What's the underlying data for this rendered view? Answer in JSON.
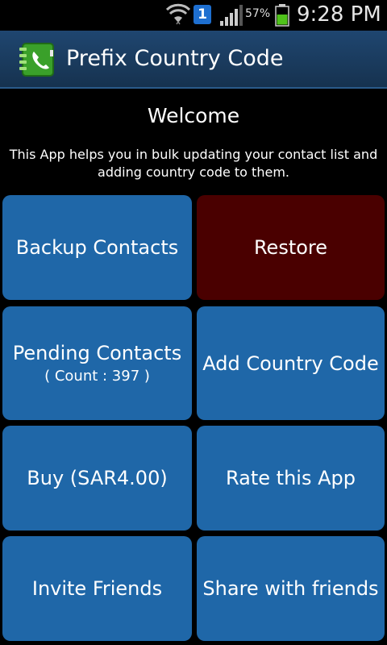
{
  "status_bar": {
    "notification_count": "1",
    "battery_percent": "57%",
    "time": "9:28 PM",
    "icons": [
      "wifi-icon",
      "notification-icon",
      "signal-icon",
      "battery-icon"
    ]
  },
  "app_bar": {
    "title": "Prefix Country Code",
    "icon": "phone-book-icon"
  },
  "welcome": {
    "title": "Welcome",
    "description": "This App helps you in bulk updating your contact list and adding country code to them."
  },
  "buttons": {
    "backup": "Backup Contacts",
    "restore": "Restore",
    "pending": "Pending Contacts",
    "pending_count": "( Count : 397 )",
    "add_country_code": "Add Country Code",
    "buy": "Buy (SAR4.00)",
    "rate": "Rate this App",
    "invite": "Invite Friends",
    "share": "Share with friends"
  },
  "colors": {
    "button_blue": "#1f67a8",
    "restore_red": "#4a0000",
    "action_bar": "#1f4670"
  }
}
